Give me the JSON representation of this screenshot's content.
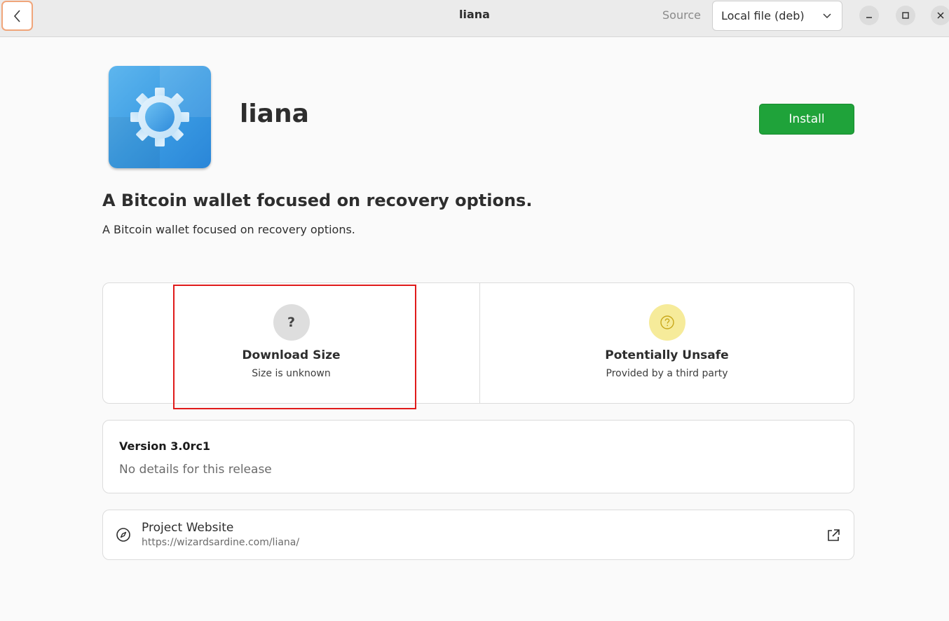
{
  "window": {
    "title": "liana",
    "source_label": "Source",
    "source_value": "Local file (deb)"
  },
  "icons": {
    "back": "chevron-left-icon",
    "dropdown": "chevron-down-icon",
    "minimize": "minimize-icon",
    "maximize": "maximize-icon",
    "close": "close-icon",
    "app": "gear-icon",
    "download_size": "question-icon",
    "safety": "warning-question-icon",
    "website": "compass-icon",
    "external": "external-link-icon"
  },
  "app": {
    "name": "liana",
    "install_label": "Install",
    "summary": "A Bitcoin wallet focused on recovery options.",
    "description": "A Bitcoin wallet focused on recovery options."
  },
  "context": {
    "download": {
      "title": "Download Size",
      "description": "Size is unknown",
      "badge": "?"
    },
    "safety": {
      "title": "Potentially Unsafe",
      "description": "Provided by a third party"
    }
  },
  "version": {
    "title": "Version 3.0rc1",
    "description": "No details for this release"
  },
  "links": {
    "title": "Project Website",
    "url": "https://wizardsardine.com/liana/"
  },
  "colors": {
    "accent_install": "#1fa33a",
    "highlight": "#e01b1b",
    "warning_badge": "#f6eb9a",
    "neutral_badge": "#dedede",
    "app_icon": "#3a9be3"
  }
}
